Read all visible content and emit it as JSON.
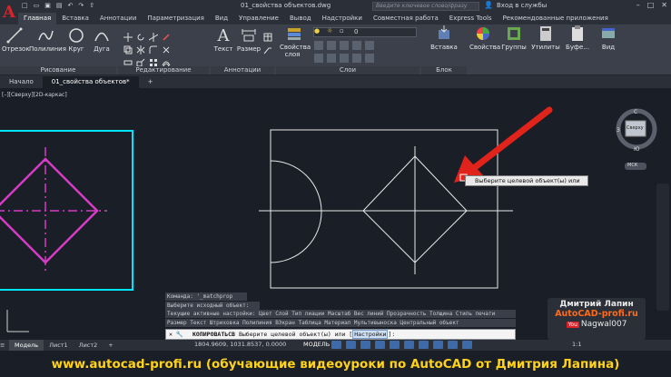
{
  "title_bar": {
    "document": "01_свойства объектов.dwg",
    "search_placeholder": "Введите ключевое слово/фразу",
    "login": "Вход в службы"
  },
  "ribbon_tabs": [
    "Главная",
    "Вставка",
    "Аннотации",
    "Параметризация",
    "Вид",
    "Управление",
    "Вывод",
    "Надстройки",
    "Совместная работа",
    "Express Tools",
    "Рекомендованные приложения"
  ],
  "ribbon": {
    "draw_tools": [
      "Отрезок",
      "Полилиния",
      "Круг",
      "Дуга"
    ],
    "draw_group": "Рисование",
    "edit_group": "Редактирование",
    "annot_tools": [
      "Текст",
      "Размер"
    ],
    "annot_group": "Аннотации",
    "layer_props": "Свойства слоя",
    "layer_value": "0",
    "layers_group": "Слои",
    "insert": "Вставка",
    "block_group": "Блок",
    "right_buttons": [
      "Свойства",
      "Группы",
      "Утилиты",
      "Буфе...",
      "Вид"
    ]
  },
  "file_tabs": [
    "Начало",
    "01_свойства объектов*"
  ],
  "viewport_label": "[–][Сверху][2D-каркас]",
  "viewcube": {
    "n": "С",
    "s": "Ю",
    "w": "З",
    "face": "Сверху",
    "ucs": "МСК"
  },
  "tooltip": "Выберите целевой объект(ы) или",
  "command_history": [
    "Команда: '_matchprop",
    "Выберите исходный объект:",
    "Текущие активные настройки:  Цвет Слой Тип лиации Масштаб Вес линий Прозрачность Толщина Стиль печати",
    "Размер Текст Штриховка Полилиния ВЭкран Таблица Материал Мультивыноска Центральный объект"
  ],
  "command_line": {
    "command": "КОПИРОВАТЬСВ",
    "prompt": "Выберите целевой объект(ы) или [",
    "option": "Настройки",
    "end": "]:"
  },
  "status": {
    "tabs": [
      "Модель",
      "Лист1",
      "Лист2"
    ],
    "coords": "1804.9609, 1031.8537, 0.0000",
    "model": "МОДЕЛЬ",
    "scale": "1:1"
  },
  "watermark": {
    "name": "Дмитрий Лапин",
    "site": "AutoCAD-profi.ru",
    "youtube": "You",
    "channel": "Nagwal007"
  },
  "footer": "www.autocad-profi.ru  (обучающие видеоуроки по AutoCAD от Дмитрия Лапина)"
}
